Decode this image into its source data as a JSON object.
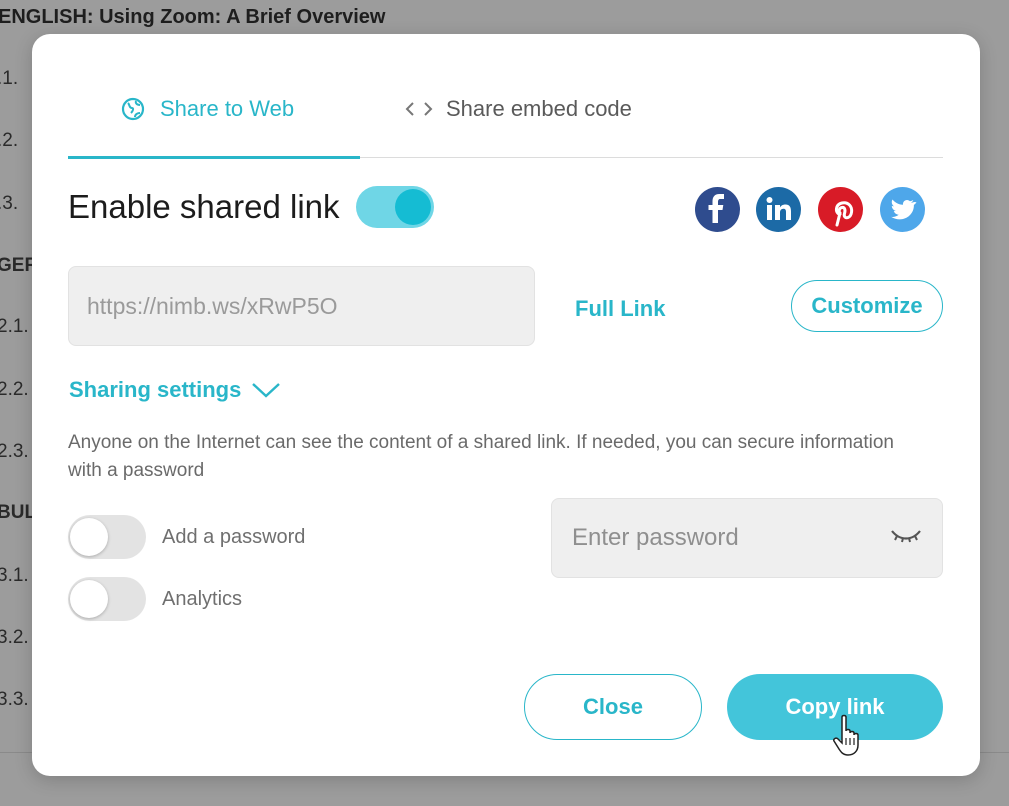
{
  "background": {
    "title": "ENGLISH: Using Zoom: A Brief Overview",
    "items": [
      ".1.",
      ".2.",
      ".3.",
      "GER",
      "2.1.",
      "2.2.",
      "2.3.",
      "BUL",
      "3.1.",
      "3.2.",
      "3.3."
    ]
  },
  "dialog": {
    "tabs": [
      {
        "label": "Share to Web",
        "icon": "globe-icon",
        "active": true
      },
      {
        "label": "Share embed code",
        "icon": "code-icon",
        "active": false
      }
    ],
    "enable_label": "Enable shared link",
    "enable_on": true,
    "social": [
      {
        "name": "facebook-icon",
        "glyph": "f"
      },
      {
        "name": "linkedin-icon",
        "glyph": "in"
      },
      {
        "name": "pinterest-icon",
        "glyph": "P"
      },
      {
        "name": "twitter-icon",
        "glyph": "t"
      }
    ],
    "link_value": "https://nimb.ws/xRwP5O",
    "full_link_label": "Full Link",
    "customize_label": "Customize",
    "sharing_settings_label": "Sharing settings",
    "description": "Anyone on the Internet can see the content of a shared link. If needed, you can secure information with a password",
    "options": [
      {
        "label": "Add a password",
        "enabled": false
      },
      {
        "label": "Analytics",
        "enabled": false
      }
    ],
    "password_placeholder": "Enter password",
    "close_label": "Close",
    "copy_label": "Copy link"
  },
  "colors": {
    "accent": "#29b6c9",
    "copy_button": "#43c5da",
    "facebook": "#2f4c8e",
    "linkedin": "#1c6aa6",
    "pinterest": "#d81b27",
    "twitter": "#4ea7ea"
  }
}
